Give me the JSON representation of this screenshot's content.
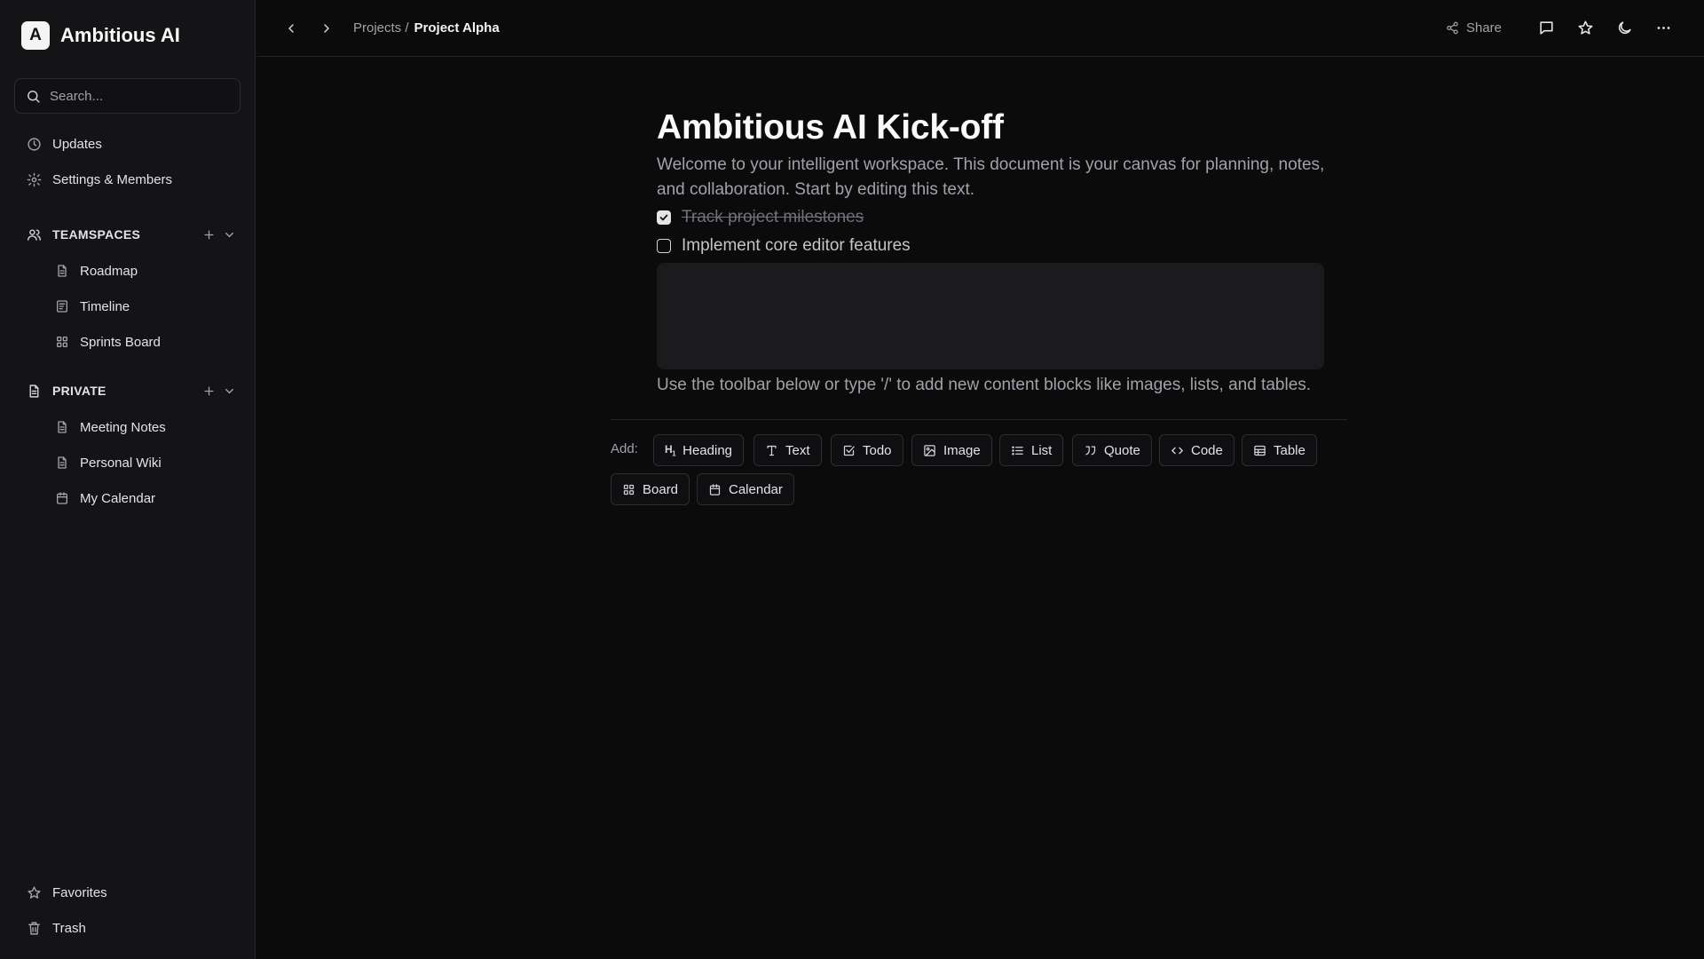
{
  "app": {
    "logo_letter": "A",
    "name": "Ambitious AI"
  },
  "search": {
    "placeholder": "Search..."
  },
  "sidebar": {
    "top_items": [
      {
        "label": "Updates",
        "icon": "clock-icon"
      },
      {
        "label": "Settings & Members",
        "icon": "gear-icon"
      }
    ],
    "teamspaces": {
      "heading": "TEAMSPACES",
      "items": [
        {
          "label": "Roadmap",
          "icon": "document-icon"
        },
        {
          "label": "Timeline",
          "icon": "timeline-icon"
        },
        {
          "label": "Sprints Board",
          "icon": "board-icon"
        }
      ]
    },
    "private": {
      "heading": "PRIVATE",
      "items": [
        {
          "label": "Meeting Notes",
          "icon": "document-icon"
        },
        {
          "label": "Personal Wiki",
          "icon": "document-icon"
        },
        {
          "label": "My Calendar",
          "icon": "calendar-icon"
        }
      ]
    },
    "bottom_items": [
      {
        "label": "Favorites",
        "icon": "star-icon"
      },
      {
        "label": "Trash",
        "icon": "trash-icon"
      }
    ]
  },
  "header": {
    "breadcrumb_parent": "Projects /",
    "breadcrumb_current": "Project Alpha",
    "share_label": "Share"
  },
  "document": {
    "title": "Ambitious AI Kick-off",
    "intro": "Welcome to your intelligent workspace. This document is your canvas for planning, notes, and collaboration. Start by editing this text.",
    "todos": [
      {
        "text": "Track project milestones",
        "checked": true
      },
      {
        "text": "Implement core editor features",
        "checked": false
      }
    ],
    "hint": "Use the toolbar below or type '/' to add new content blocks like images, lists, and tables."
  },
  "toolbar": {
    "add_label": "Add:",
    "buttons": [
      {
        "label": "Heading",
        "icon": "heading-icon"
      },
      {
        "label": "Text",
        "icon": "text-icon"
      },
      {
        "label": "Todo",
        "icon": "todo-icon"
      },
      {
        "label": "Image",
        "icon": "image-icon"
      },
      {
        "label": "List",
        "icon": "list-icon"
      },
      {
        "label": "Quote",
        "icon": "quote-icon"
      },
      {
        "label": "Code",
        "icon": "code-icon"
      },
      {
        "label": "Table",
        "icon": "table-icon"
      },
      {
        "label": "Board",
        "icon": "board-icon"
      },
      {
        "label": "Calendar",
        "icon": "calendar-icon"
      }
    ]
  },
  "colors": {
    "background": "#0b0b0c",
    "sidebar": "#141416",
    "text_primary": "#fafafa",
    "text_muted": "#a1a1aa"
  }
}
